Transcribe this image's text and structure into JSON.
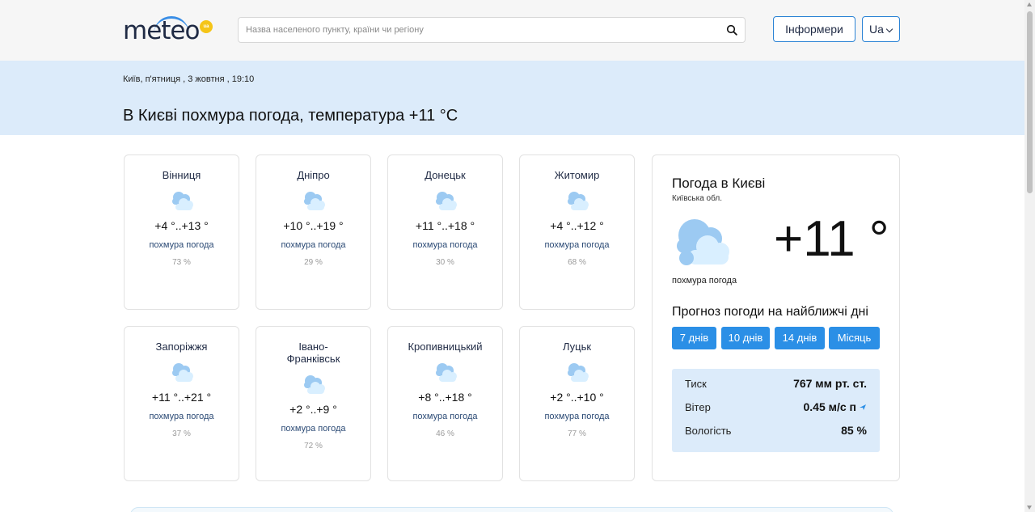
{
  "header": {
    "logo_text": "meteo",
    "logo_badge": "ua",
    "search_placeholder": "Назва населеного пункту, країни чи регіону",
    "search_icon": "search-icon",
    "informers_label": "Інформери",
    "lang_label": "Ua"
  },
  "banner": {
    "date_line": "Київ, п'ятниця , 3 жовтня , 19:10",
    "title": "В Києві похмура погода, температура +11 °C"
  },
  "cities": [
    {
      "name": "Вінниця",
      "temp": "+4 °..+13 °",
      "desc": "похмура погода",
      "humidity": "73 %",
      "icon": "cloudy-icon"
    },
    {
      "name": "Дніпро",
      "temp": "+10 °..+19 °",
      "desc": "похмура погода",
      "humidity": "29 %",
      "icon": "cloudy-icon"
    },
    {
      "name": "Донецьк",
      "temp": "+11 °..+18 °",
      "desc": "похмура погода",
      "humidity": "30 %",
      "icon": "cloudy-icon"
    },
    {
      "name": "Житомир",
      "temp": "+4 °..+12 °",
      "desc": "похмура погода",
      "humidity": "68 %",
      "icon": "cloudy-icon"
    },
    {
      "name": "Запоріжжя",
      "temp": "+11 °..+21 °",
      "desc": "похмура погода",
      "humidity": "37 %",
      "icon": "cloudy-icon"
    },
    {
      "name": "Івано-Франківськ",
      "temp": "+2 °..+9 °",
      "desc": "похмура погода",
      "humidity": "72 %",
      "icon": "cloudy-icon"
    },
    {
      "name": "Кропивницький",
      "temp": "+8 °..+18 °",
      "desc": "похмура погода",
      "humidity": "46 %",
      "icon": "cloudy-icon"
    },
    {
      "name": "Луцьк",
      "temp": "+2 °..+10 °",
      "desc": "похмура погода",
      "humidity": "77 %",
      "icon": "cloudy-icon"
    }
  ],
  "current": {
    "title": "Погода в Києві",
    "region": "Київська обл.",
    "temp": "+11 °",
    "desc": "похмура погода",
    "icon": "cloudy-icon",
    "forecast_title": "Прогноз погоди на найближчі дні",
    "forecast_buttons": [
      "7 днів",
      "10 днів",
      "14 днів",
      "Місяць"
    ],
    "stats": [
      {
        "label": "Тиск",
        "value": "767 мм рт. ст."
      },
      {
        "label": "Вітер",
        "value": "0.45 м/с п",
        "icon": "wind-direction-icon"
      },
      {
        "label": "Вологість",
        "value": "85 %"
      }
    ]
  },
  "colors": {
    "accent": "#2b8fe6",
    "banner_bg": "#dcebfa",
    "header_bg": "#f6f6f6"
  }
}
